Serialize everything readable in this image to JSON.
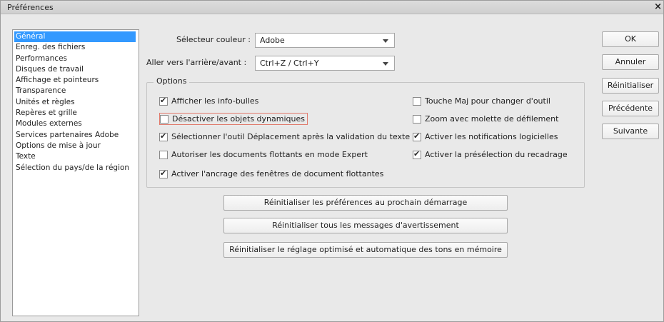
{
  "window": {
    "title": "Préférences",
    "close_glyph": "×"
  },
  "sidebar": {
    "items": [
      {
        "label": "Général",
        "selected": true
      },
      {
        "label": "Enreg. des fichiers"
      },
      {
        "label": "Performances"
      },
      {
        "label": "Disques de travail"
      },
      {
        "label": "Affichage et pointeurs"
      },
      {
        "label": "Transparence"
      },
      {
        "label": "Unités et règles"
      },
      {
        "label": "Repères et grille"
      },
      {
        "label": "Modules externes"
      },
      {
        "label": "Services partenaires Adobe"
      },
      {
        "label": "Options de mise à jour"
      },
      {
        "label": "Texte"
      },
      {
        "label": "Sélection du pays/de la région"
      }
    ]
  },
  "fields": {
    "color_picker": {
      "label": "Sélecteur couleur :",
      "value": "Adobe"
    },
    "undo_redo": {
      "label": "Aller vers l'arrière/avant :",
      "value": "Ctrl+Z / Ctrl+Y"
    }
  },
  "options": {
    "title": "Options",
    "checkboxes": [
      {
        "label": "Afficher les info-bulles",
        "checked": true
      },
      {
        "label": "Désactiver les objets dynamiques",
        "checked": false
      },
      {
        "label": "Sélectionner l'outil Déplacement après la validation du texte",
        "checked": true
      },
      {
        "label": "Autoriser les documents flottants en mode Expert",
        "checked": false
      },
      {
        "label": "Activer l'ancrage des fenêtres de document flottantes",
        "checked": true
      },
      {
        "label": "Touche Maj pour changer d'outil",
        "checked": false
      },
      {
        "label": "Zoom avec molette de défilement",
        "checked": false
      },
      {
        "label": "Activer les notifications logicielles",
        "checked": true
      },
      {
        "label": "Activer la présélection du recadrage",
        "checked": true
      }
    ]
  },
  "reset_buttons": [
    "Réinitialiser les préférences au prochain démarrage",
    "Réinitialiser tous les messages d'avertissement",
    "Réinitialiser le réglage optimisé et automatique des tons en mémoire"
  ],
  "actions": {
    "ok": "OK",
    "cancel": "Annuler",
    "reset": "Réinitialiser",
    "previous": "Précédente",
    "next": "Suivante"
  }
}
